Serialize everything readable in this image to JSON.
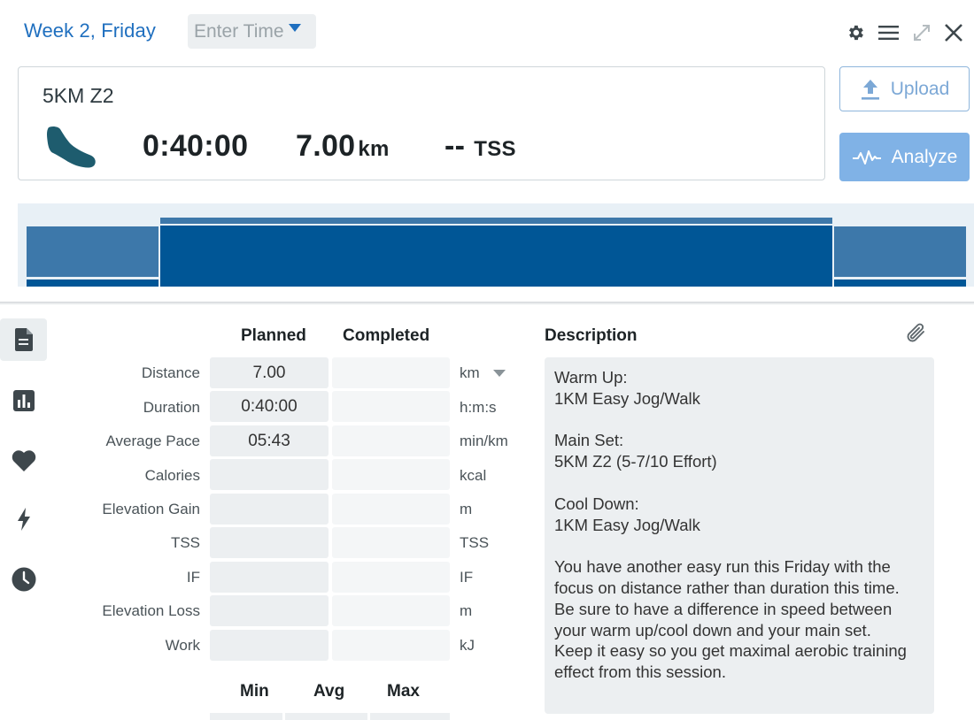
{
  "header": {
    "title": "Week 2, Friday",
    "time_placeholder": "Enter Time"
  },
  "icons": {
    "settings": "gear-icon",
    "menu": "hamburger-menu-icon",
    "expand": "expand-icon",
    "close": "close-icon",
    "sport": "running-shoe-icon",
    "upload": "upload-icon",
    "analyze": "pulse-icon",
    "attach": "paperclip-icon",
    "rail": [
      "document-icon",
      "bar-chart-icon",
      "heart-icon",
      "lightning-icon",
      "clock-icon"
    ]
  },
  "summary": {
    "workout_name": "5KM Z2",
    "duration": "0:40:00",
    "distance": "7.00",
    "distance_unit": "km",
    "tss": "--",
    "tss_unit": "TSS"
  },
  "buttons": {
    "upload": "Upload",
    "analyze": "Analyze"
  },
  "table": {
    "planned_header": "Planned",
    "completed_header": "Completed",
    "rows": [
      {
        "label": "Distance",
        "planned": "7.00",
        "completed": "",
        "unit": "km"
      },
      {
        "label": "Duration",
        "planned": "0:40:00",
        "completed": "",
        "unit": "h:m:s"
      },
      {
        "label": "Average Pace",
        "planned": "05:43",
        "completed": "",
        "unit": "min/km"
      },
      {
        "label": "Calories",
        "planned": "",
        "completed": "",
        "unit": "kcal"
      },
      {
        "label": "Elevation Gain",
        "planned": "",
        "completed": "",
        "unit": "m"
      },
      {
        "label": "TSS",
        "planned": "",
        "completed": "",
        "unit": "TSS"
      },
      {
        "label": "IF",
        "planned": "",
        "completed": "",
        "unit": "IF"
      },
      {
        "label": "Elevation Loss",
        "planned": "",
        "completed": "",
        "unit": "m"
      },
      {
        "label": "Work",
        "planned": "",
        "completed": "",
        "unit": "kJ"
      }
    ],
    "min_header": "Min",
    "avg_header": "Avg",
    "max_header": "Max"
  },
  "description": {
    "header": "Description",
    "text": "Warm Up:\n1KM Easy Jog/Walk\n\nMain Set:\n5KM Z2 (5-7/10 Effort)\n\nCool Down:\n1KM Easy Jog/Walk\n\nYou have another easy run this Friday with the focus on distance rather than duration this time.\nBe sure to have a difference in speed between your warm up/cool down and your main set.\nKeep it easy so you get maximal aerobic training effect from this session."
  },
  "colors": {
    "accent": "#1f6fbf",
    "graph_main": "#005696",
    "graph_side": "#3d78aa",
    "graph_bg": "#e8f0f6",
    "analyze_bg": "#80b2e6"
  }
}
